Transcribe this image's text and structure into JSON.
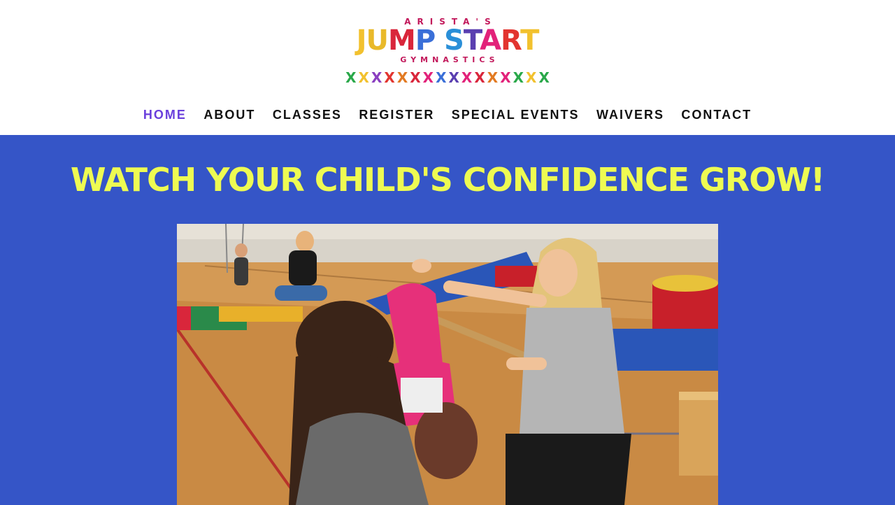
{
  "colors": {
    "header_bg": "#ffffff",
    "hero_bg": "#3555c7",
    "headline": "#eefb52",
    "nav_active": "#6a3fdc",
    "nav_default": "#111111"
  },
  "logo": {
    "top_text": "ARISTA'S",
    "main_letters": [
      {
        "ch": "J",
        "color": "#f2c12e"
      },
      {
        "ch": "U",
        "color": "#e9b92a"
      },
      {
        "ch": "M",
        "color": "#d9263b"
      },
      {
        "ch": "P",
        "color": "#3a6fd8"
      },
      {
        "ch": " ",
        "color": "#000000"
      },
      {
        "ch": "S",
        "color": "#2a8fd8"
      },
      {
        "ch": "T",
        "color": "#5a3fb0"
      },
      {
        "ch": "A",
        "color": "#e2227a"
      },
      {
        "ch": "R",
        "color": "#e2342f"
      },
      {
        "ch": "T",
        "color": "#f2c12e"
      }
    ],
    "bottom_text": "GYMNASTICS",
    "figure_colors": [
      "#2aa84a",
      "#f2c12e",
      "#8a3fc0",
      "#e2342f",
      "#e27a22",
      "#d9263b",
      "#e2227a",
      "#3a6fd8",
      "#5a3fb0",
      "#e2227a",
      "#d9263b",
      "#e27a22",
      "#e2227a",
      "#2aa84a",
      "#f2c12e",
      "#2aa84a"
    ]
  },
  "nav": {
    "items": [
      {
        "label": "HOME",
        "active": true
      },
      {
        "label": "ABOUT",
        "active": false
      },
      {
        "label": "CLASSES",
        "active": false
      },
      {
        "label": "REGISTER",
        "active": false
      },
      {
        "label": "SPECIAL EVENTS",
        "active": false
      },
      {
        "label": "WAIVERS",
        "active": false
      },
      {
        "label": "CONTACT",
        "active": false
      }
    ]
  },
  "hero": {
    "headline": "WATCH YOUR CHILD'S CONFIDENCE GROW!"
  }
}
